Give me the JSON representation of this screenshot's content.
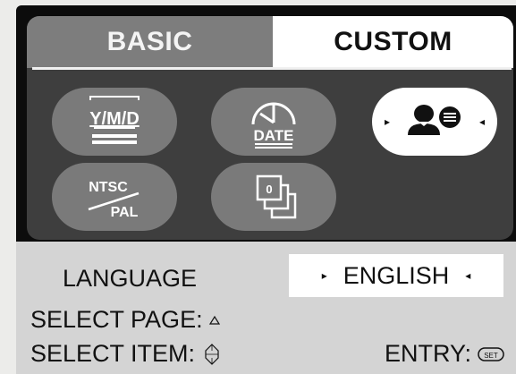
{
  "tabs": {
    "basic": "BASIC",
    "custom": "CUSTOM"
  },
  "icons": {
    "date_format": "Y/M/D",
    "date_imprint": "DATE",
    "language": "language-icon",
    "video_out_top": "NTSC",
    "video_out_bottom": "PAL",
    "file_numbering": "file-number-icon"
  },
  "language": {
    "label": "LANGUAGE",
    "value": "ENGLISH"
  },
  "help": {
    "select_page": "SELECT PAGE:",
    "select_item": "SELECT ITEM:",
    "entry": "ENTRY:"
  },
  "colors": {
    "panel": "#3e3e3e",
    "pill": "#7a7a7a",
    "selected": "#ffffff",
    "info_bar": "#d4d4d4"
  }
}
